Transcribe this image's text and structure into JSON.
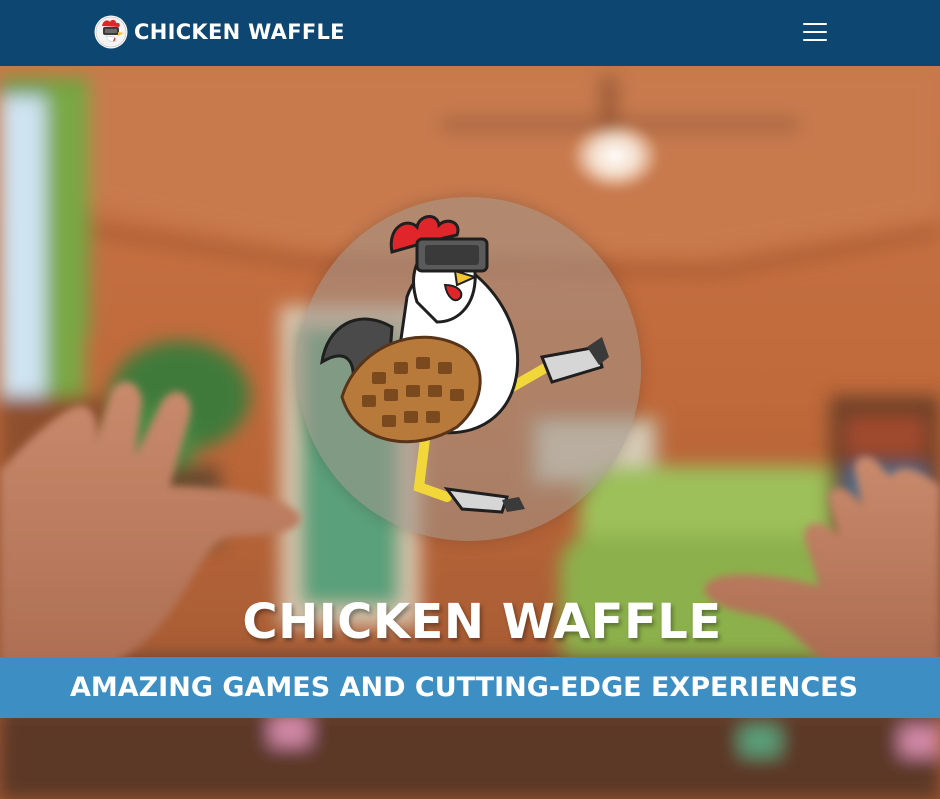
{
  "navbar": {
    "brand_name": "CHICKEN WAFFLE",
    "brand_logo_icon": "chicken-vr-logo-icon",
    "menu_icon": "hamburger-menu-icon",
    "background_color": "#0c4671"
  },
  "hero": {
    "title": "CHICKEN WAFFLE",
    "tagline": "AMAZING GAMES AND CUTTING-EDGE EXPERIENCES",
    "mascot_icon": "chicken-waffle-vr-mascot-icon",
    "tagline_band_color": "#3d8fc3",
    "background_scene": "blurred-vr-living-room-with-hands"
  }
}
